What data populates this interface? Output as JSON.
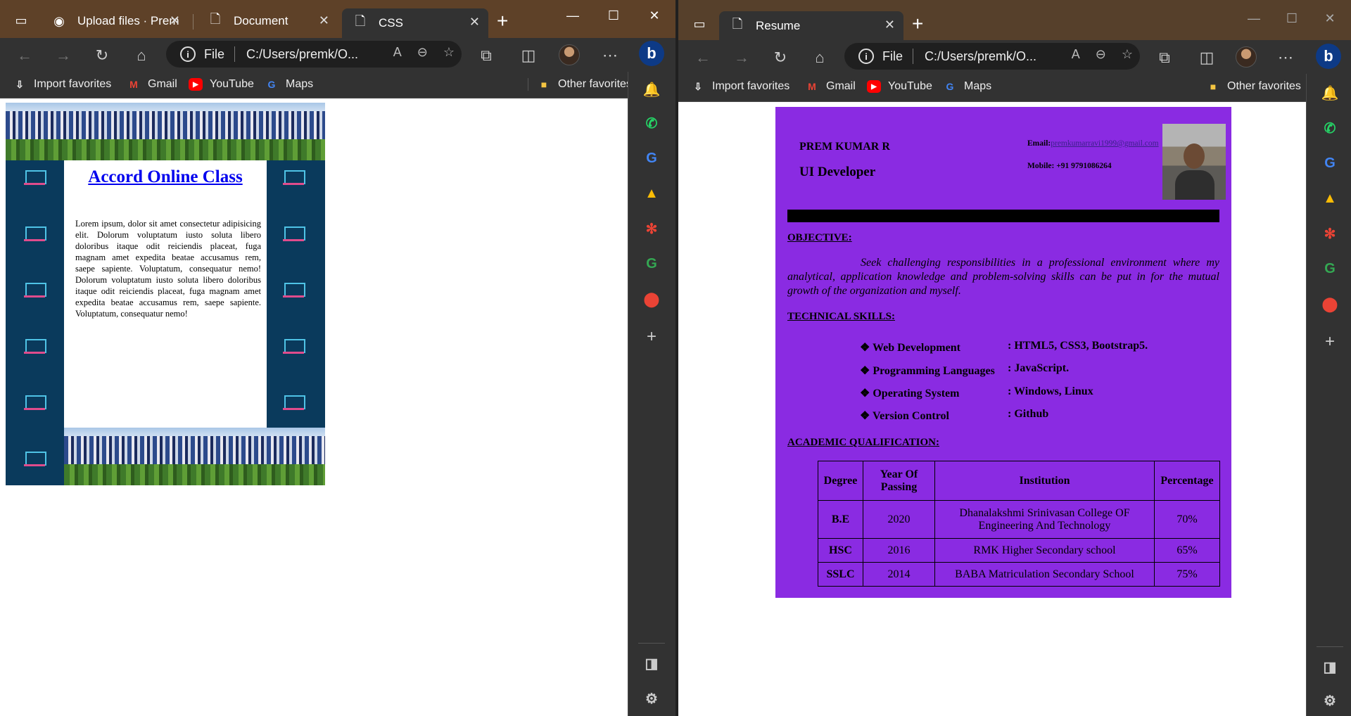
{
  "left_window": {
    "tabs": [
      {
        "label": "Upload files · Prem",
        "icon": "github-icon"
      },
      {
        "label": "Document",
        "icon": "page-icon"
      },
      {
        "label": "CSS",
        "icon": "page-icon"
      }
    ],
    "address": {
      "scheme": "File",
      "path": "C:/Users/premk/O..."
    },
    "favorites": [
      "Import favorites",
      "Gmail",
      "YouTube",
      "Maps"
    ],
    "other_favorites": "Other favorites",
    "page": {
      "title": "Accord Online Class",
      "paragraph": "Lorem ipsum, dolor sit amet consectetur adipisicing elit. Dolorum voluptatum iusto soluta libero doloribus itaque odit reiciendis placeat, fuga magnam amet expedita beatae accusamus rem, saepe sapiente. Voluptatum, consequatur nemo! Dolorum voluptatum iusto soluta libero doloribus itaque odit reiciendis placeat, fuga magnam amet expedita beatae accusamus rem, saepe sapiente. Voluptatum, consequatur nemo!"
    }
  },
  "right_window": {
    "tabs": [
      {
        "label": "Resume",
        "icon": "page-icon"
      }
    ],
    "address": {
      "scheme": "File",
      "path": "C:/Users/premk/O..."
    },
    "favorites": [
      "Import favorites",
      "Gmail",
      "YouTube",
      "Maps"
    ],
    "other_favorites": "Other favorites",
    "resume": {
      "name": "PREM KUMAR R",
      "role": "UI Developer",
      "email_label": "Email:",
      "email": "premkumarravi1999@gmail.com",
      "mobile": "Mobile: +91 9791086264",
      "objective_heading": "OBJECTIVE:",
      "objective": "Seek challenging responsibilities in a professional environment where my analytical, application knowledge and problem-solving skills can be put in for the mutual growth of the organization and myself.",
      "skills_heading": "TECHNICAL SKILLS:",
      "skills": [
        {
          "label": "❖ Web Development",
          "value": ": HTML5, CSS3, Bootstrap5."
        },
        {
          "label": "❖ Programming Languages",
          "value": ": JavaScript."
        },
        {
          "label": "❖ Operating System",
          "value": ": Windows, Linux"
        },
        {
          "label": "❖ Version Control",
          "value": ": Github"
        }
      ],
      "academic_heading": "ACADEMIC QUALIFICATION:",
      "table": {
        "headers": [
          "Degree",
          "Year Of Passing",
          "Institution",
          "Percentage"
        ],
        "rows": [
          [
            "B.E",
            "2020",
            "Dhanalakshmi Srinivasan College OF Engineering And Technology",
            "70%"
          ],
          [
            "HSC",
            "2016",
            "RMK Higher Secondary school",
            "65%"
          ],
          [
            "SSLC",
            "2014",
            "BABA Matriculation Secondary School",
            "75%"
          ]
        ]
      }
    }
  },
  "colors": {
    "resume_bg": "#8a2be2",
    "css_frame_bg": "#0a3a5c",
    "titlebar": "#5e4128",
    "toolbar": "#323232"
  }
}
